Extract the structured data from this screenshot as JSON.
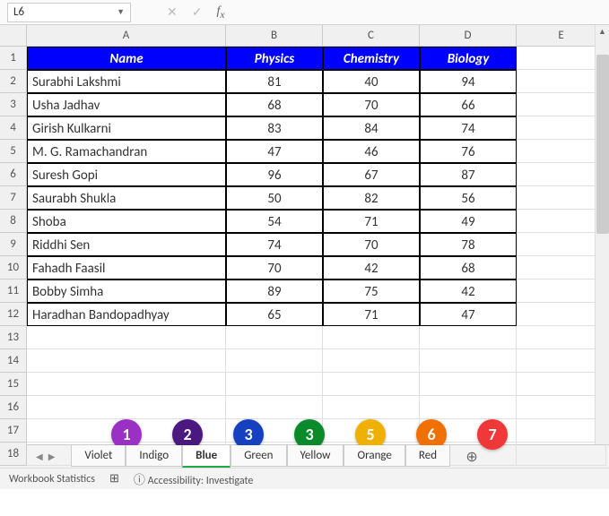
{
  "name_box": "L6",
  "formula_value": "",
  "columns": [
    "A",
    "B",
    "C",
    "D",
    "E"
  ],
  "row_numbers": [
    "1",
    "2",
    "3",
    "4",
    "5",
    "6",
    "7",
    "8",
    "9",
    "10",
    "11",
    "12",
    "13",
    "14",
    "15",
    "16",
    "17",
    "18"
  ],
  "headers": {
    "A": "Name",
    "B": "Physics",
    "C": "Chemistry",
    "D": "Biology"
  },
  "data": [
    {
      "name": "Surabhi Lakshmi",
      "p": "81",
      "c": "40",
      "b": "94"
    },
    {
      "name": "Usha Jadhav",
      "p": "68",
      "c": "70",
      "b": "66"
    },
    {
      "name": "Girish Kulkarni",
      "p": "83",
      "c": "84",
      "b": "74"
    },
    {
      "name": "M. G. Ramachandran",
      "p": "47",
      "c": "46",
      "b": "76"
    },
    {
      "name": "Suresh Gopi",
      "p": "96",
      "c": "67",
      "b": "87"
    },
    {
      "name": "Saurabh Shukla",
      "p": "50",
      "c": "82",
      "b": "56"
    },
    {
      "name": "Shoba",
      "p": "54",
      "c": "71",
      "b": "49"
    },
    {
      "name": "Riddhi Sen",
      "p": "74",
      "c": "70",
      "b": "78"
    },
    {
      "name": "Fahadh Faasil",
      "p": "70",
      "c": "42",
      "b": "68"
    },
    {
      "name": "Bobby Simha",
      "p": "89",
      "c": "75",
      "b": "42"
    },
    {
      "name": "Haradhan Bandopadhyay",
      "p": "65",
      "c": "71",
      "b": "47"
    }
  ],
  "circles": [
    {
      "label": "1",
      "color": "#9b30c4"
    },
    {
      "label": "2",
      "color": "#4b1880"
    },
    {
      "label": "3",
      "color": "#1540c0"
    },
    {
      "label": "3",
      "color": "#0a8a2a"
    },
    {
      "label": "5",
      "color": "#f0b000"
    },
    {
      "label": "6",
      "color": "#f07000"
    },
    {
      "label": "7",
      "color": "#f03838"
    }
  ],
  "tabs": [
    {
      "label": "Violet",
      "active": false
    },
    {
      "label": "Indigo",
      "active": false
    },
    {
      "label": "Blue",
      "active": true
    },
    {
      "label": "Green",
      "active": false
    },
    {
      "label": "Yellow",
      "active": false
    },
    {
      "label": "Orange",
      "active": false
    },
    {
      "label": "Red",
      "active": false
    }
  ],
  "status": {
    "stats": "Workbook Statistics",
    "accessibility": "Accessibility: Investigate"
  }
}
